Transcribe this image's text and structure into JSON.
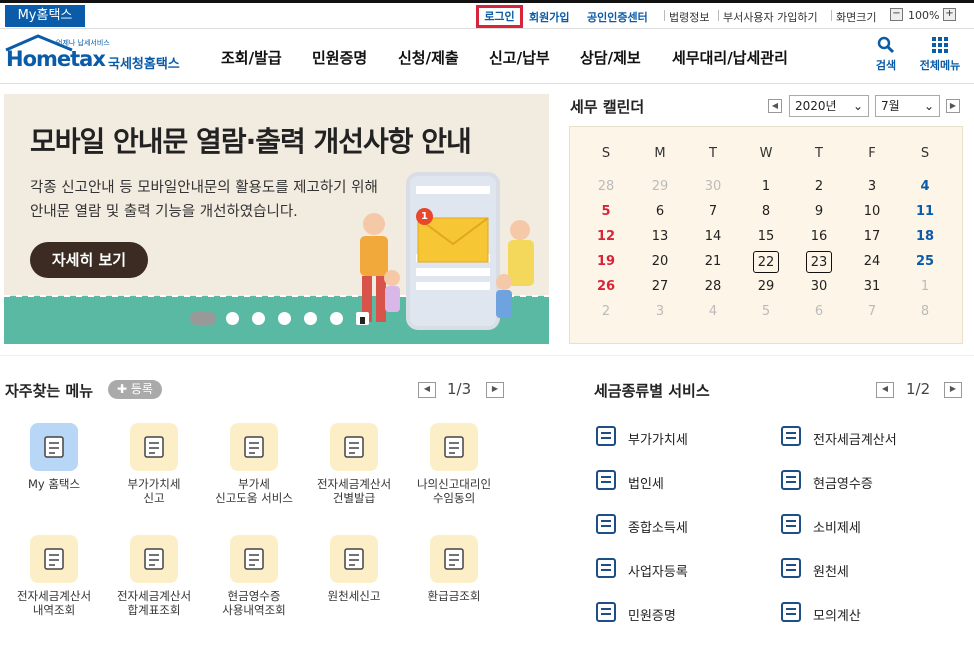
{
  "utility": {
    "myhome": "My홈택스",
    "login": "로그인",
    "join": "회원가입",
    "cert": "공인인증센터",
    "law": "법령정보",
    "dept_user": "부서사용자 가입하기",
    "screen_size": "화면크기",
    "zoom": "100%"
  },
  "logo": {
    "tagline": "언제나 납세서비스",
    "name": "Hometax",
    "brand": "국세청홈택스"
  },
  "nav": [
    "조회/발급",
    "민원증명",
    "신청/제출",
    "신고/납부",
    "상담/제보",
    "세무대리/납세관리"
  ],
  "tools": {
    "search": "검색",
    "allmenu": "전체메뉴"
  },
  "banner": {
    "title": "모바일 안내문 열람·출력 개선사항 안내",
    "desc1": "각종 신고안내 등 모바일안내문의 활용도를 제고하기 위해",
    "desc2": "안내문 열람 및 출력 기능을 개선하였습니다.",
    "button": "자세히 보기",
    "badge": "1"
  },
  "calendar": {
    "title": "세무 캘린더",
    "year": "2020년",
    "month": "7월",
    "headers": [
      "S",
      "M",
      "T",
      "W",
      "T",
      "F",
      "S"
    ],
    "weeks": [
      [
        "28",
        "29",
        "30",
        "1",
        "2",
        "3",
        "4"
      ],
      [
        "5",
        "6",
        "7",
        "8",
        "9",
        "10",
        "11"
      ],
      [
        "12",
        "13",
        "14",
        "15",
        "16",
        "17",
        "18"
      ],
      [
        "19",
        "20",
        "21",
        "22",
        "23",
        "24",
        "25"
      ],
      [
        "26",
        "27",
        "28",
        "29",
        "30",
        "31",
        "1"
      ],
      [
        "2",
        "3",
        "4",
        "5",
        "6",
        "7",
        "8"
      ]
    ]
  },
  "favorites": {
    "title": "자주찾는 메뉴",
    "add": "등록",
    "page": "1/3",
    "items": [
      [
        "My 홈택스"
      ],
      [
        "부가가치세",
        "신고"
      ],
      [
        "부가세",
        "신고도움 서비스"
      ],
      [
        "전자세금계산서",
        "건별발급"
      ],
      [
        "나의신고대리인",
        "수임동의"
      ],
      [
        "전자세금계산서",
        "내역조회"
      ],
      [
        "전자세금계산서",
        "합계표조회"
      ],
      [
        "현금영수증",
        "사용내역조회"
      ],
      [
        "원천세신고"
      ],
      [
        "환급금조회"
      ]
    ]
  },
  "services": {
    "title": "세금종류별 서비스",
    "page": "1/2",
    "items": [
      "부가가치세",
      "전자세금계산서",
      "법인세",
      "현금영수증",
      "종합소득세",
      "소비제세",
      "사업자등록",
      "원천세",
      "민원증명",
      "모의계산"
    ]
  },
  "colors": {
    "accent": "#0b5ca8",
    "highlight": "#d6253a",
    "icon_bg": "#fcefc8"
  }
}
